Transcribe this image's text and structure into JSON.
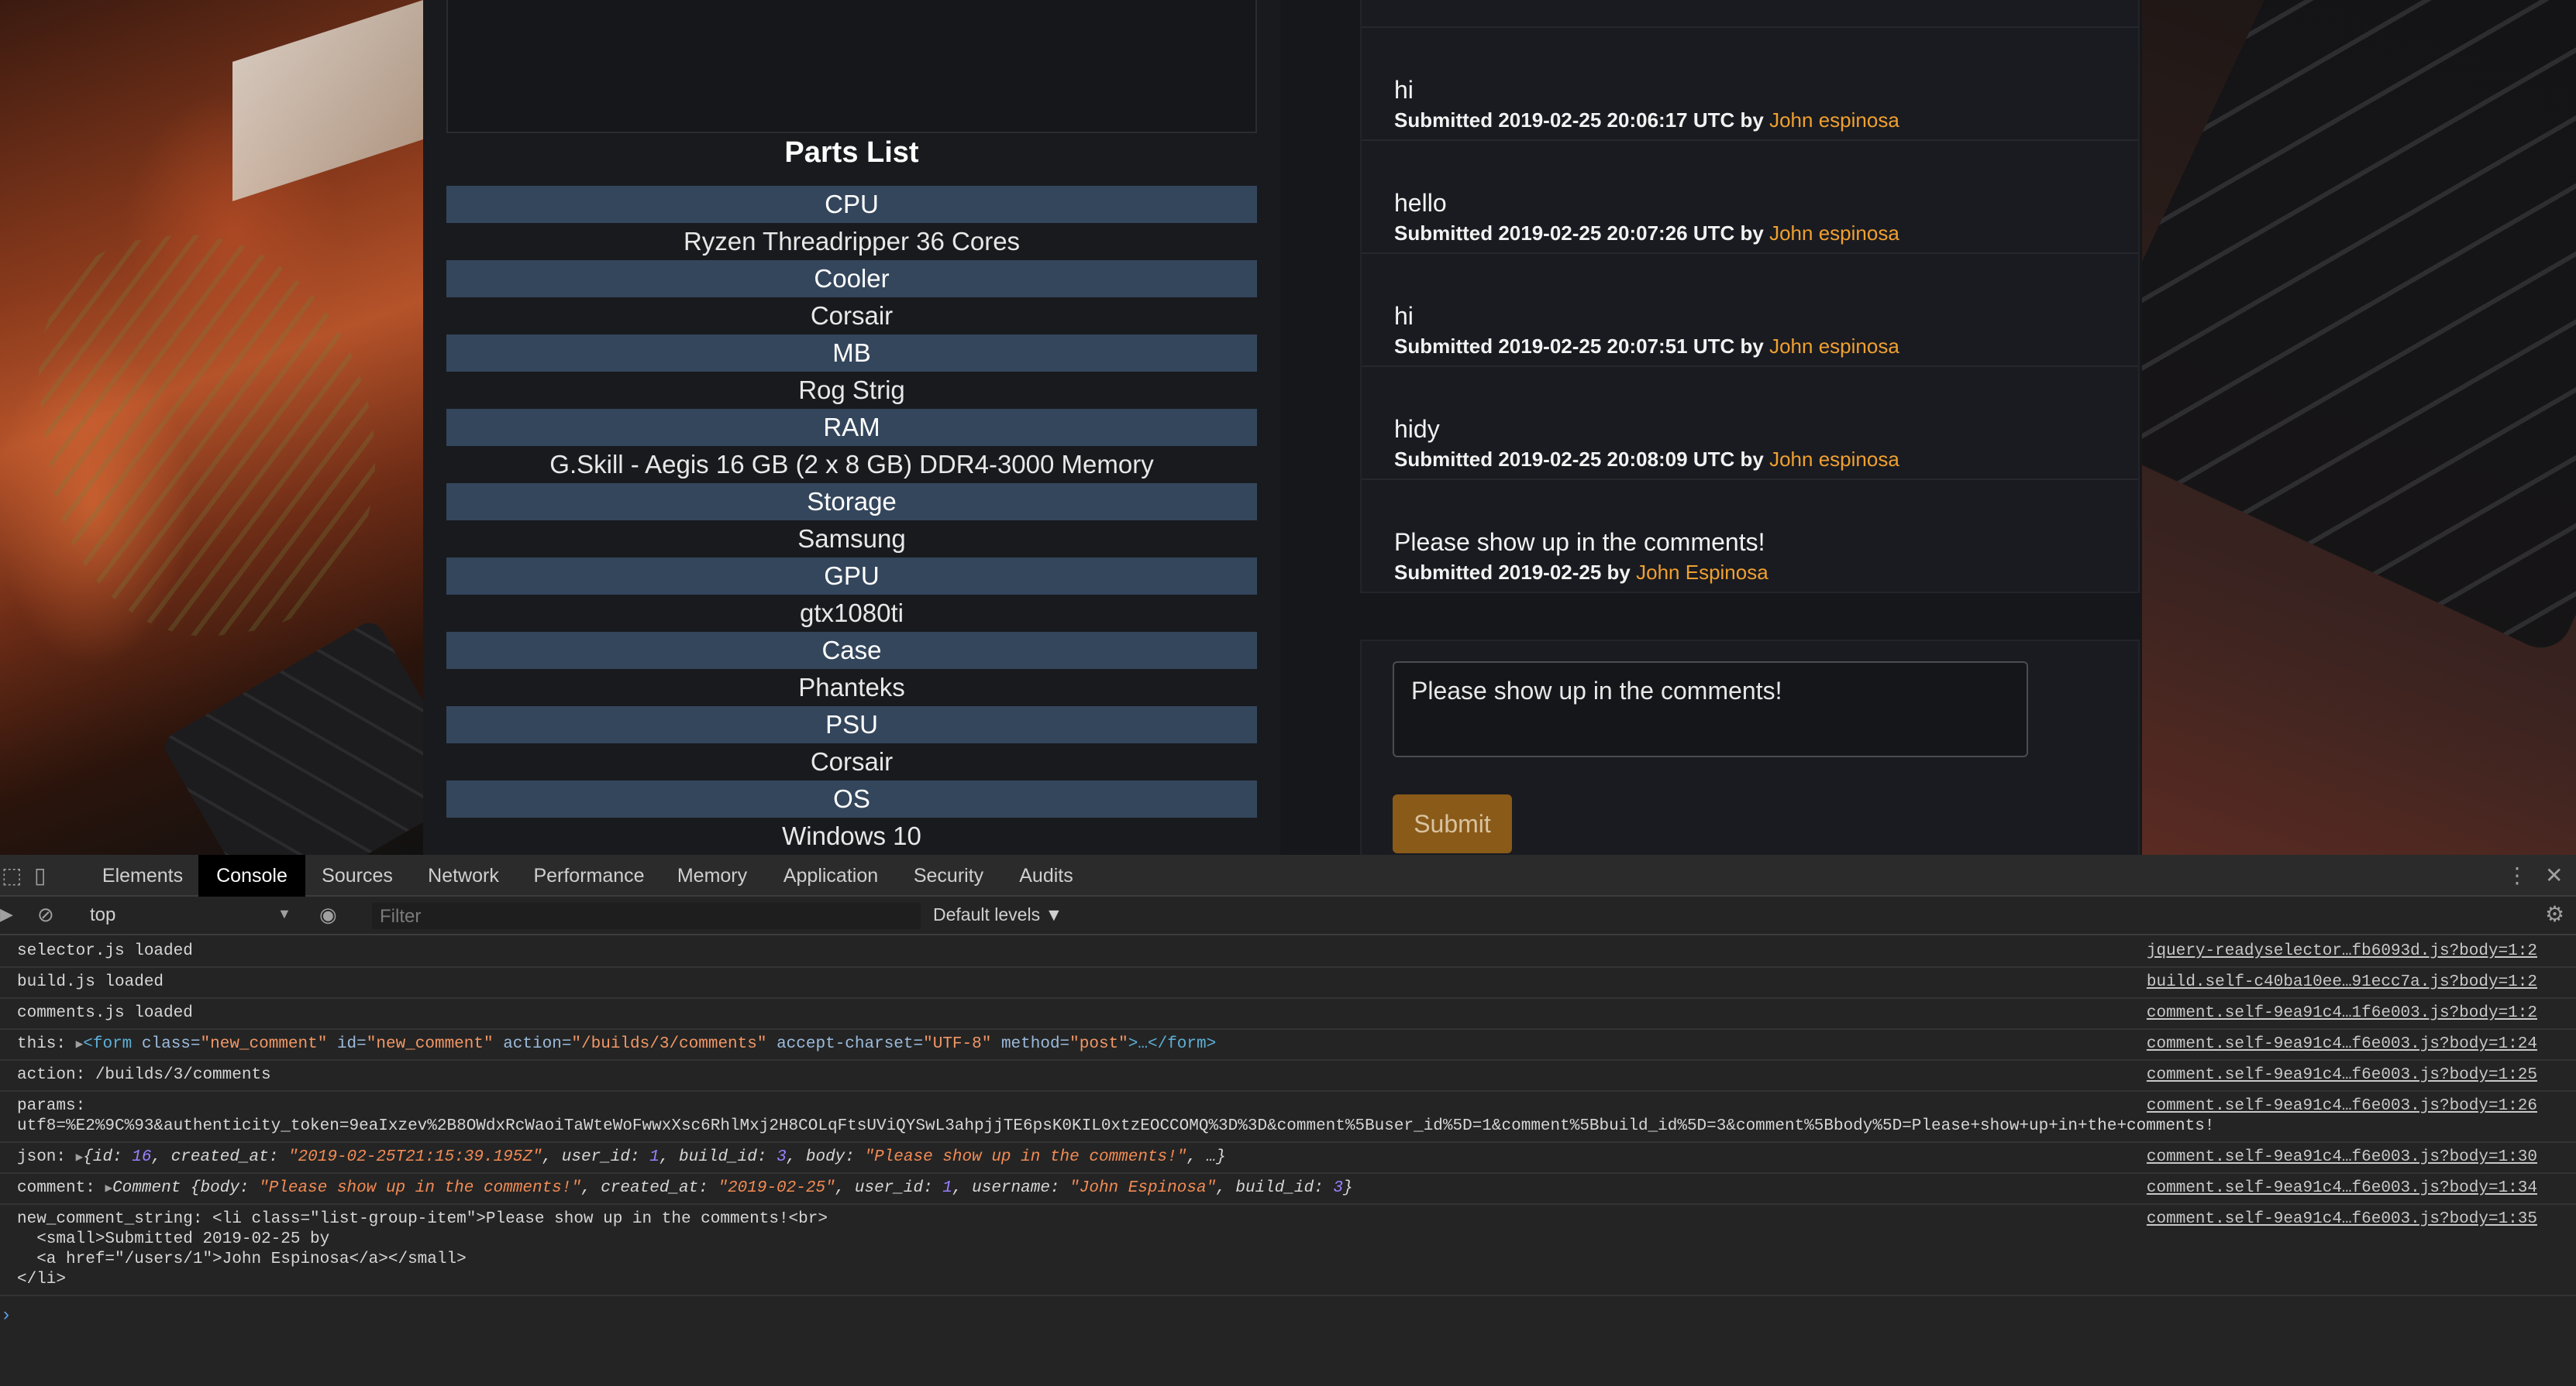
{
  "parts": {
    "title": "Parts List",
    "items": [
      {
        "label": "CPU",
        "value": "Ryzen Threadripper 36 Cores"
      },
      {
        "label": "Cooler",
        "value": "Corsair"
      },
      {
        "label": "MB",
        "value": "Rog Strig"
      },
      {
        "label": "RAM",
        "value": "G.Skill - Aegis 16 GB (2 x 8 GB) DDR4-3000 Memory"
      },
      {
        "label": "Storage",
        "value": "Samsung"
      },
      {
        "label": "GPU",
        "value": "gtx1080ti"
      },
      {
        "label": "Case",
        "value": "Phanteks"
      },
      {
        "label": "PSU",
        "value": "Corsair"
      },
      {
        "label": "OS",
        "value": "Windows 10"
      }
    ]
  },
  "comments": {
    "items": [
      {
        "body": "hi",
        "meta": "Submitted 2019-02-25 20:06:17 UTC by",
        "author": "John espinosa"
      },
      {
        "body": "hello",
        "meta": "Submitted 2019-02-25 20:07:26 UTC by",
        "author": "John espinosa"
      },
      {
        "body": "hi",
        "meta": "Submitted 2019-02-25 20:07:51 UTC by",
        "author": "John espinosa"
      },
      {
        "body": "hidy",
        "meta": "Submitted 2019-02-25 20:08:09 UTC by",
        "author": "John espinosa"
      },
      {
        "body": "Please show up in the comments!",
        "meta": "Submitted 2019-02-25 by",
        "author": "John Espinosa"
      }
    ],
    "textarea_value": "Please show up in the comments!",
    "submit_label": "Submit"
  },
  "devtools": {
    "tabs": [
      "Elements",
      "Console",
      "Sources",
      "Network",
      "Performance",
      "Memory",
      "Application",
      "Security",
      "Audits"
    ],
    "active_tab": "Console",
    "context": "top",
    "filter_placeholder": "Filter",
    "levels": "Default levels ▼",
    "logs": {
      "l1": {
        "text": "selector.js loaded",
        "src": "jquery-readyselector…fb6093d.js?body=1:2"
      },
      "l2": {
        "text": "build.js loaded",
        "src": "build.self-c40ba10ee…91ecc7a.js?body=1:2"
      },
      "l3": {
        "text": "comments.js loaded",
        "src": "comment.self-9ea91c4…1f6e003.js?body=1:2"
      },
      "l4": {
        "label": "this:",
        "form_open": "<form",
        "class_attr": "class=",
        "class_val": "\"new_comment\"",
        "id_attr": "id=",
        "id_val": "\"new_comment\"",
        "action_attr": "action=",
        "action_val": "\"/builds/3/comments\"",
        "charset_attr": "accept-charset=",
        "charset_val": "\"UTF-8\"",
        "method_attr": "method=",
        "method_val": "\"post\"",
        "form_close": ">…</form>",
        "src": "comment.self-9ea91c4…f6e003.js?body=1:24"
      },
      "l5": {
        "text": "action: /builds/3/comments",
        "src": "comment.self-9ea91c4…f6e003.js?body=1:25"
      },
      "l6": {
        "label": "params:",
        "text": "utf8=%E2%9C%93&authenticity_token=9eaIxzev%2B8OWdxRcWaoiTaWteWoFwwxXsc6RhlMxj2H8COLqFtsUViQYSwL3ahpjjTE6psK0KIL0xtzEOCCOMQ%3D%3D&comment%5Buser_id%5D=1&comment%5Bbuild_id%5D=3&comment%5Bbody%5D=Please+show+up+in+the+comments!",
        "src": "comment.self-9ea91c4…f6e003.js?body=1:26"
      },
      "l7": {
        "label": "json:",
        "open": "{id: ",
        "id": "16",
        "ca_key": ", created_at: ",
        "ca": "\"2019-02-25T21:15:39.195Z\"",
        "uid_key": ", user_id: ",
        "uid": "1",
        "bid_key": ", build_id: ",
        "bid": "3",
        "body_key": ", body: ",
        "body": "\"Please show up in the comments!\"",
        "close": ", …}",
        "src": "comment.self-9ea91c4…f6e003.js?body=1:30"
      },
      "l8": {
        "label": "comment:",
        "cls": "Comment ",
        "open": "{body: ",
        "body": "\"Please show up in the comments!\"",
        "ca_key": ", created_at: ",
        "ca": "\"2019-02-25\"",
        "uid_key": ", user_id: ",
        "uid": "1",
        "un_key": ", username: ",
        "un": "\"John Espinosa\"",
        "bid_key": ", build_id: ",
        "bid": "3",
        "close": "}",
        "src": "comment.self-9ea91c4…f6e003.js?body=1:34"
      },
      "l9": {
        "line1": "new_comment_string: <li class=\"list-group-item\">Please show up in the comments!<br>",
        "line2": "  <small>Submitted 2019-02-25 by",
        "line3": "  <a href=\"/users/1\">John Espinosa</a></small>",
        "line4": "</li>",
        "src": "comment.self-9ea91c4…f6e003.js?body=1:35"
      }
    },
    "prompt": "›"
  }
}
